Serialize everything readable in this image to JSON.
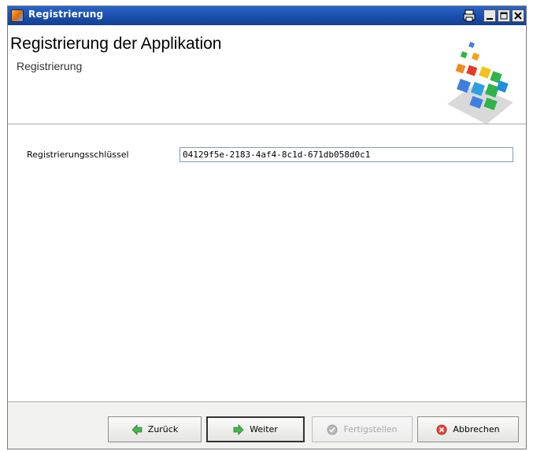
{
  "window": {
    "title": "Registrierung",
    "controls": [
      "print-icon",
      "minimize-icon",
      "maximize-icon",
      "close-icon"
    ]
  },
  "header": {
    "title": "Registrierung der Applikation",
    "subtitle": "Registrierung",
    "logo_icon": "colored-cubes-logo"
  },
  "form": {
    "key_label": "Registrierungsschlüssel",
    "key_value": "04129f5e-2183-4af4-8c1d-671db058d0c1"
  },
  "buttons": {
    "back": "Zurück",
    "next": "Weiter",
    "finish": "Fertigstellen",
    "cancel": "Abbrechen"
  },
  "colors": {
    "titlebar": "#1a4fae",
    "arrow_green": "#46b84a",
    "cancel_red": "#e04a3a"
  }
}
